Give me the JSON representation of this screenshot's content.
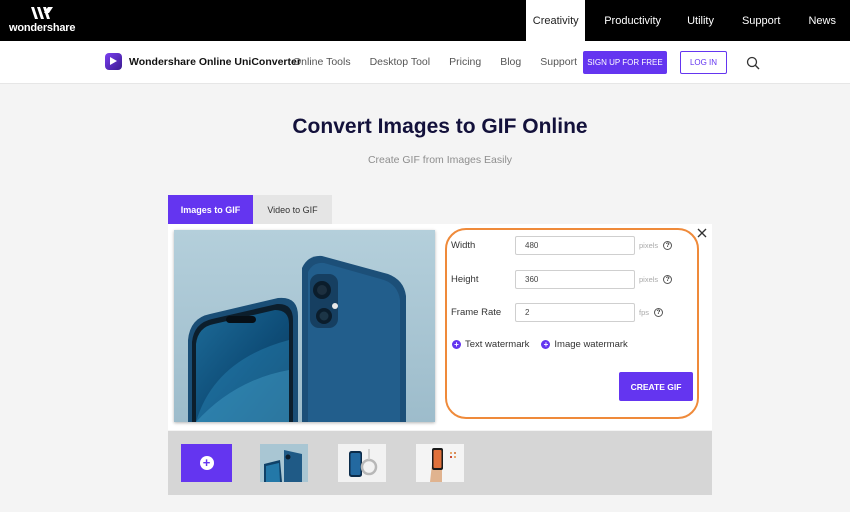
{
  "brand": {
    "company": "wondershare",
    "product": "Wondershare Online UniConverter"
  },
  "topnav": {
    "items": [
      "Creativity",
      "Productivity",
      "Utility",
      "Support",
      "News"
    ],
    "active": "Creativity"
  },
  "mainnav": {
    "items": [
      "Online Tools",
      "Desktop Tool",
      "Pricing",
      "Blog",
      "Support"
    ],
    "signup_label": "SIGN UP FOR FREE",
    "login_label": "LOG IN"
  },
  "hero": {
    "title": "Convert Images to GIF Online",
    "subtitle": "Create GIF from Images Easily"
  },
  "tabs": [
    {
      "label": "Images to GIF",
      "active": true
    },
    {
      "label": "Video to GIF",
      "active": false
    }
  ],
  "form": {
    "width": {
      "label": "Width",
      "value": "480",
      "unit": "pixels"
    },
    "height": {
      "label": "Height",
      "value": "360",
      "unit": "pixels"
    },
    "frame_rate": {
      "label": "Frame Rate",
      "value": "2",
      "unit": "fps"
    },
    "text_watermark_label": "Text watermark",
    "image_watermark_label": "Image watermark",
    "create_label": "CREATE GIF",
    "help_glyph": "?"
  },
  "colors": {
    "accent": "#6435f0",
    "highlight_outline": "#ef8a3a",
    "topbar": "#000000"
  },
  "icons": [
    "wondershare-logo-icon",
    "uniconverter-icon",
    "search-icon",
    "close-icon",
    "help-icon",
    "plus-icon",
    "add-image-icon"
  ]
}
